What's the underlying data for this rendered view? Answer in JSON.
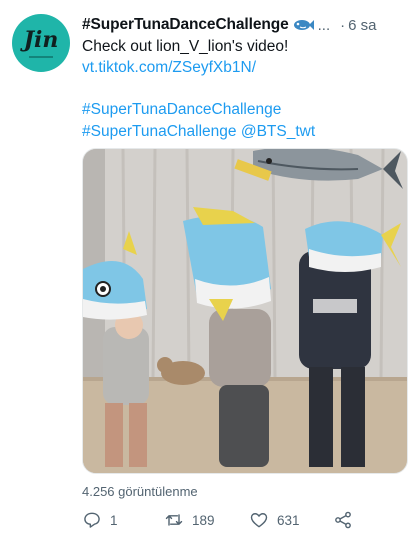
{
  "author": {
    "display_name": "#SuperTunaDanceChallenge",
    "name_ellipsis": "...",
    "avatar_text": "Jin",
    "name_emoji": "fish-emoji"
  },
  "meta": {
    "separator": "·",
    "time": "6 sa"
  },
  "body": {
    "line1": "Check out lion_V_lion's video!",
    "link": "vt.tiktok.com/ZSeyfXb1N/",
    "hashtag1": "#SuperTunaDanceChallenge",
    "hashtag2": "#SuperTunaChallenge",
    "mention": "@BTS_twt"
  },
  "views": "4.256 görüntülenme",
  "actions": {
    "reply_count": "1",
    "retweet_count": "189",
    "like_count": "631"
  },
  "colors": {
    "link": "#1d9bf0",
    "text": "#0f1419",
    "muted": "#536471",
    "avatar_bg": "#1fb5a9"
  },
  "icons": [
    "reply-icon",
    "retweet-icon",
    "like-icon",
    "share-icon"
  ]
}
